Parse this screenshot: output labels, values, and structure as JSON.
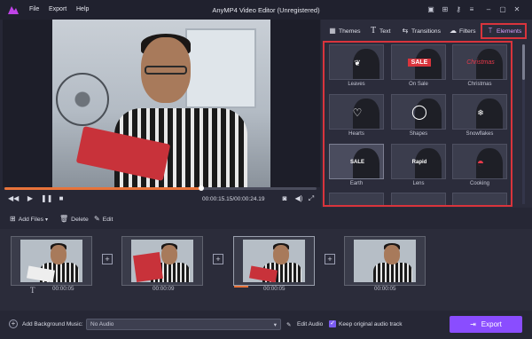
{
  "titlebar": {
    "title": "AnyMP4 Video Editor (Unregistered)",
    "menu": [
      "File",
      "Export",
      "Help"
    ],
    "icons": [
      "save-icon",
      "cart-icon",
      "key-icon",
      "menu-icon",
      "minimize-icon",
      "maximize-icon",
      "close-icon"
    ]
  },
  "player": {
    "timecode": "00:00:15.15/00:00:24.19",
    "progress": 0.63
  },
  "tabs": [
    {
      "label": "Themes",
      "icon": "grid-icon"
    },
    {
      "label": "Text",
      "icon": "text-icon"
    },
    {
      "label": "Transitions",
      "icon": "transitions-icon"
    },
    {
      "label": "Filters",
      "icon": "filters-icon"
    },
    {
      "label": "Elements",
      "icon": "elements-icon"
    }
  ],
  "elements": [
    {
      "label": "Leaves"
    },
    {
      "label": "On Sale",
      "badge": "SALE"
    },
    {
      "label": "Christmas",
      "badge": "Christmas"
    },
    {
      "label": "Hearts"
    },
    {
      "label": "Shapes"
    },
    {
      "label": "Snowflakes"
    },
    {
      "label": "Earth",
      "badge": "SALE"
    },
    {
      "label": "Lens",
      "badge": "Rapid"
    },
    {
      "label": "Cooking"
    }
  ],
  "toolbar": {
    "add_files": "Add Files",
    "delete": "Delete",
    "edit": "Edit"
  },
  "timeline": {
    "durations": [
      "00:00:05",
      "00:00:09",
      "00:00:05",
      "00:00:05"
    ]
  },
  "bottom": {
    "add_music_label": "Add Background Music:",
    "audio_value": "No Audio",
    "edit_audio": "Edit Audio",
    "keep_audio": "Keep original audio track",
    "export": "Export"
  },
  "colors": {
    "accent": "#8a4dff",
    "highlight": "#d9343c",
    "progress": "#e8733a"
  }
}
